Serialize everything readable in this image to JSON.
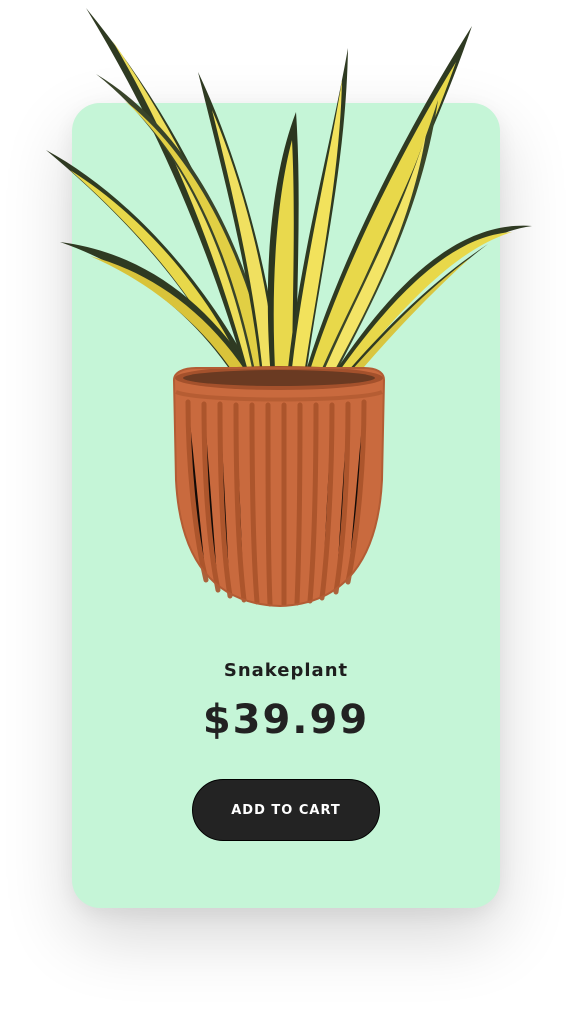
{
  "product": {
    "name": "Snakeplant",
    "price": "$39.99",
    "image_icon": "snake-plant-in-terracotta-pot-icon"
  },
  "actions": {
    "add_to_cart_label": "ADD TO CART"
  },
  "colors": {
    "card_background": "#c5f5d7",
    "button_background": "#232323",
    "pot": "#c96a3e",
    "leaf_yellow": "#e8d84a",
    "leaf_dark": "#2f3a22"
  }
}
